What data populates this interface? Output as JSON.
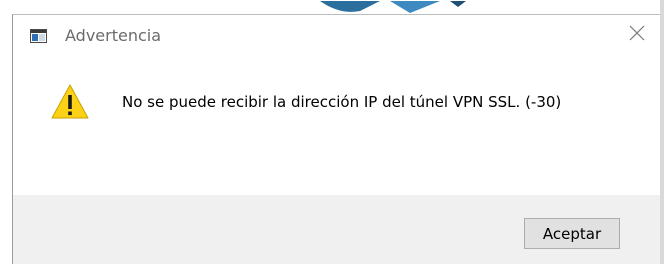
{
  "dialog": {
    "title": "Advertencia",
    "message": "No se puede recibir la dirección IP del túnel VPN SSL. (-30)",
    "ok_label": "Aceptar",
    "close_glyph": "✕"
  },
  "icons": {
    "app": "app-window-icon",
    "warning": "warning-icon",
    "close": "close-icon"
  },
  "colors": {
    "warning_fill": "#fcd116",
    "footer_bg": "#f0f0f0",
    "button_bg": "#e1e1e1"
  }
}
